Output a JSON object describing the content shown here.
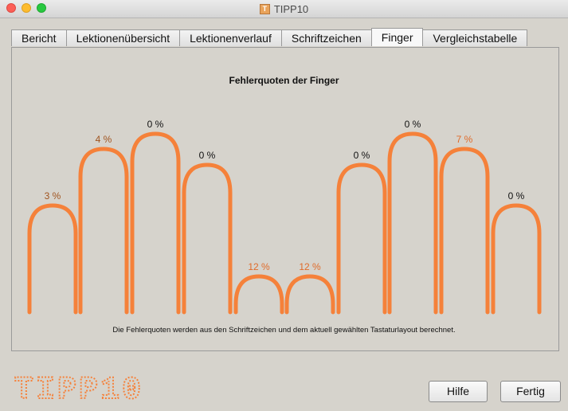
{
  "window": {
    "title": "TIPP10"
  },
  "tabs": [
    {
      "label": "Bericht",
      "active": false
    },
    {
      "label": "Lektionenübersicht",
      "active": false
    },
    {
      "label": "Lektionenverlauf",
      "active": false
    },
    {
      "label": "Schriftzeichen",
      "active": false
    },
    {
      "label": "Finger",
      "active": true
    },
    {
      "label": "Vergleichstabelle",
      "active": false
    }
  ],
  "chart_data": {
    "type": "bar",
    "title": "Fehlerquoten der Finger",
    "values": [
      3,
      4,
      0,
      0,
      12,
      12,
      0,
      0,
      7,
      0
    ],
    "labels": [
      "3 %",
      "4 %",
      "0 %",
      "0 %",
      "12 %",
      "12 %",
      "0 %",
      "0 %",
      "7 %",
      "0 %"
    ],
    "label_colors": [
      "#a0541f",
      "#a0541f",
      "#111111",
      "#111111",
      "#e06b2a",
      "#e06b2a",
      "#111111",
      "#111111",
      "#e06b2a",
      "#111111"
    ],
    "arch_color": "#f5813a"
  },
  "chart_note": "Die Fehlerquoten werden aus den Schriftzeichen und dem aktuell gewählten Tastaturlayout berechnet.",
  "logo_text": "TIPP10",
  "buttons": {
    "help": "Hilfe",
    "done": "Fertig"
  }
}
